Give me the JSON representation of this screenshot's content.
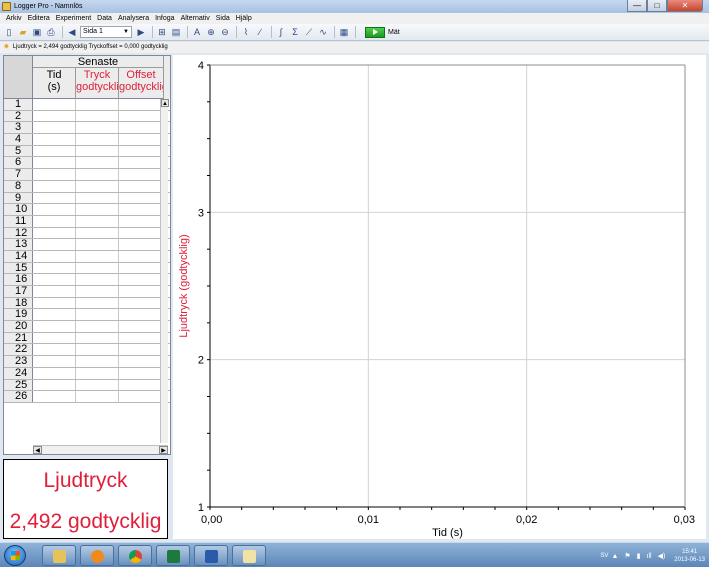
{
  "window": {
    "title": "Logger Pro - Namnlös",
    "controls": {
      "minimize": "—",
      "maximize": "□",
      "close": "✕"
    }
  },
  "menu": [
    "Arkiv",
    "Editera",
    "Experiment",
    "Data",
    "Analysera",
    "Infoga",
    "Alternativ",
    "Sida",
    "Hjälp"
  ],
  "toolbar": {
    "page_select": "Sida 1",
    "collect_label": "Mät",
    "icons": [
      "new-file-icon",
      "open-folder-icon",
      "save-icon",
      "print-icon",
      "back-page-icon",
      "forward-page-icon",
      "data-browser-icon",
      "notebook-icon",
      "autoscale-icon",
      "zoom-in-icon",
      "zoom-out-icon",
      "examine-icon",
      "tangent-icon",
      "integral-icon",
      "statistics-icon",
      "linear-fit-icon",
      "curve-fit-icon",
      "model-icon",
      "replay-icon"
    ]
  },
  "status_line": "Ljudtryck = 2,494 godtycklig  Tryckoffset = 0,000 godtycklig",
  "table": {
    "group_header": "Senaste",
    "columns": [
      {
        "line1": "Tid",
        "line2": "(s)",
        "color": "#000000"
      },
      {
        "line1": "Tryck",
        "line2": "godtycklig",
        "color": "#e0203b"
      },
      {
        "line1": "Offset",
        "line2": "godtycklig",
        "color": "#e0203b"
      }
    ],
    "row_numbers": [
      "1",
      "2",
      "3",
      "4",
      "5",
      "6",
      "7",
      "8",
      "9",
      "10",
      "11",
      "12",
      "13",
      "14",
      "15",
      "16",
      "17",
      "18",
      "19",
      "20",
      "21",
      "22",
      "23",
      "24",
      "25",
      "26"
    ]
  },
  "meter": {
    "name": "Ljudtryck",
    "reading": "2,492 godtycklig"
  },
  "chart_data": {
    "type": "line",
    "xlabel": "Tid (s)",
    "ylabel": "Ljudtryck (godtycklig)",
    "xlim": [
      0,
      0.03
    ],
    "ylim": [
      1,
      4
    ],
    "x_ticks": [
      0,
      0.01,
      0.02,
      0.03
    ],
    "x_tick_labels": [
      "0,00",
      "0,01",
      "0,02",
      "0,03"
    ],
    "y_ticks": [
      1,
      2,
      3,
      4
    ],
    "y_tick_labels": [
      "1",
      "2",
      "3",
      "4"
    ],
    "grid": true,
    "series": [],
    "colors": {
      "ylabel": "#e0203b",
      "grid": "#d2d2d2"
    }
  },
  "taskbar": {
    "apps": [
      "file-explorer-icon",
      "media-player-icon",
      "chrome-icon",
      "excel-icon",
      "word-icon",
      "logger-pro-icon"
    ],
    "language": "SV",
    "time": "15:41",
    "date": "2013-06-13"
  }
}
